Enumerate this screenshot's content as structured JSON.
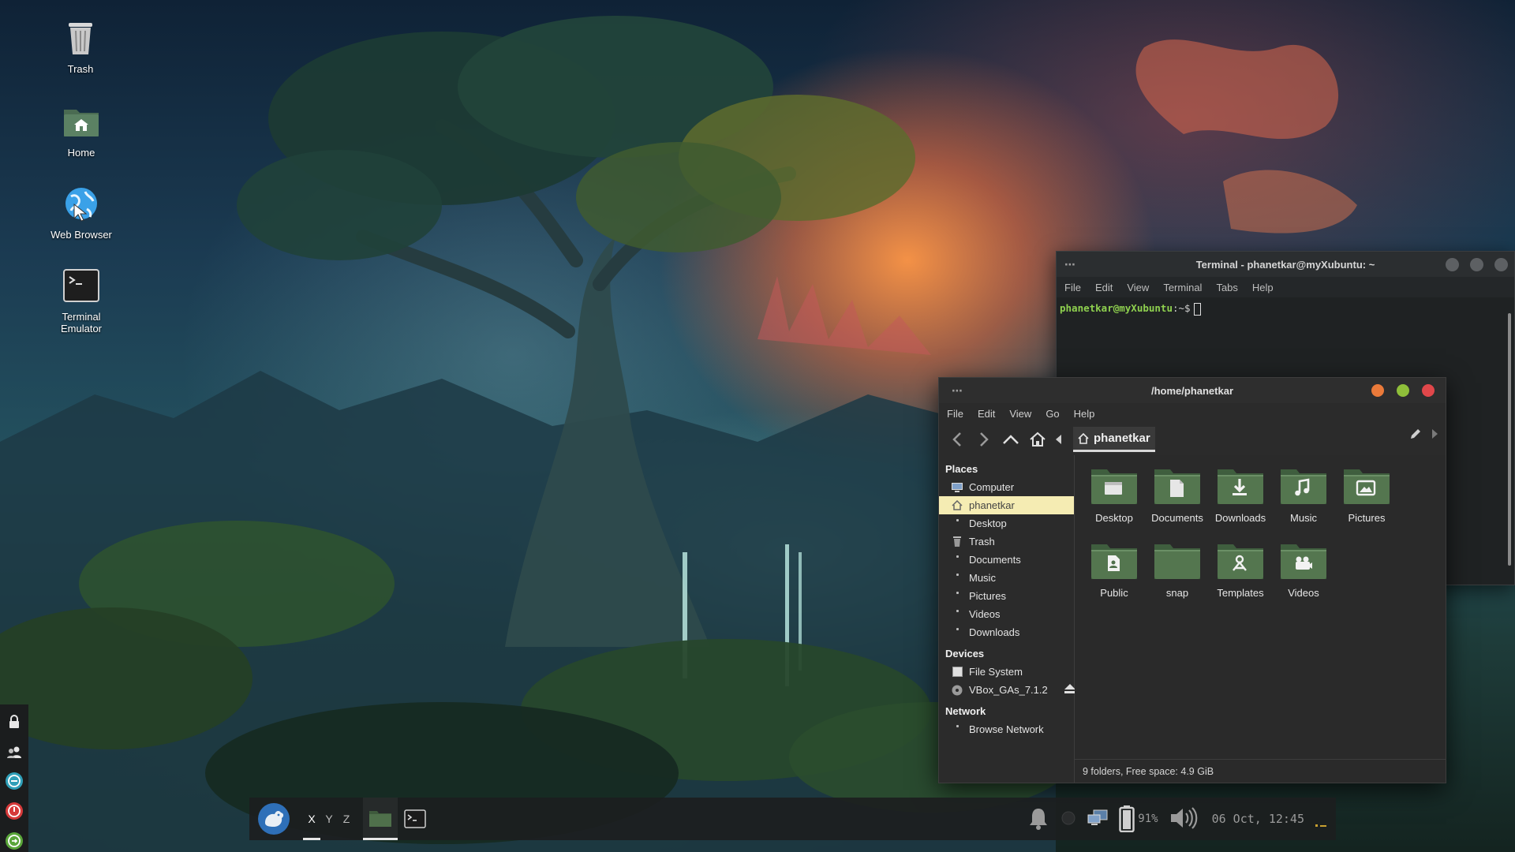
{
  "desktop": {
    "icons": [
      {
        "label": "Trash",
        "icon": "trash-icon"
      },
      {
        "label": "Home",
        "icon": "home-folder-icon"
      },
      {
        "label": "Web Browser",
        "icon": "web-browser-icon"
      },
      {
        "label": "Terminal\nEmulator",
        "icon": "terminal-icon"
      }
    ]
  },
  "terminal": {
    "title": "Terminal - phanetkar@myXubuntu: ~",
    "menu": [
      "File",
      "Edit",
      "View",
      "Terminal",
      "Tabs",
      "Help"
    ],
    "prompt": "phanetkar@myXubuntu",
    "prompt_suffix": ":~$"
  },
  "file_manager": {
    "title": "/home/phanetkar",
    "menu": [
      "File",
      "Edit",
      "View",
      "Go",
      "Help"
    ],
    "path_label": "phanetkar",
    "sidebar": {
      "places_header": "Places",
      "places": [
        "Computer",
        "phanetkar",
        "Desktop",
        "Trash",
        "Documents",
        "Music",
        "Pictures",
        "Videos",
        "Downloads"
      ],
      "devices_header": "Devices",
      "devices": [
        "File System",
        "VBox_GAs_7.1.2"
      ],
      "network_header": "Network",
      "network": [
        "Browse Network"
      ]
    },
    "folders": [
      {
        "label": "Desktop",
        "emblem": "desktop"
      },
      {
        "label": "Documents",
        "emblem": "document"
      },
      {
        "label": "Downloads",
        "emblem": "download"
      },
      {
        "label": "Music",
        "emblem": "music"
      },
      {
        "label": "Pictures",
        "emblem": "picture"
      },
      {
        "label": "Public",
        "emblem": "public"
      },
      {
        "label": "snap",
        "emblem": "none"
      },
      {
        "label": "Templates",
        "emblem": "template"
      },
      {
        "label": "Videos",
        "emblem": "video"
      }
    ],
    "status": "9 folders, Free space: 4.9 GiB"
  },
  "panel": {
    "workspaces": [
      "X",
      "Y",
      "Z"
    ],
    "battery": "91%",
    "clock": "06 Oct, 12:45"
  },
  "colors": {
    "close": "#e0474a",
    "maximize": "#8fbf3a",
    "minimize": "#ea7a3a",
    "sidebar_selected": "#f5ecb3",
    "terminal_prompt": "#8fd14f"
  }
}
